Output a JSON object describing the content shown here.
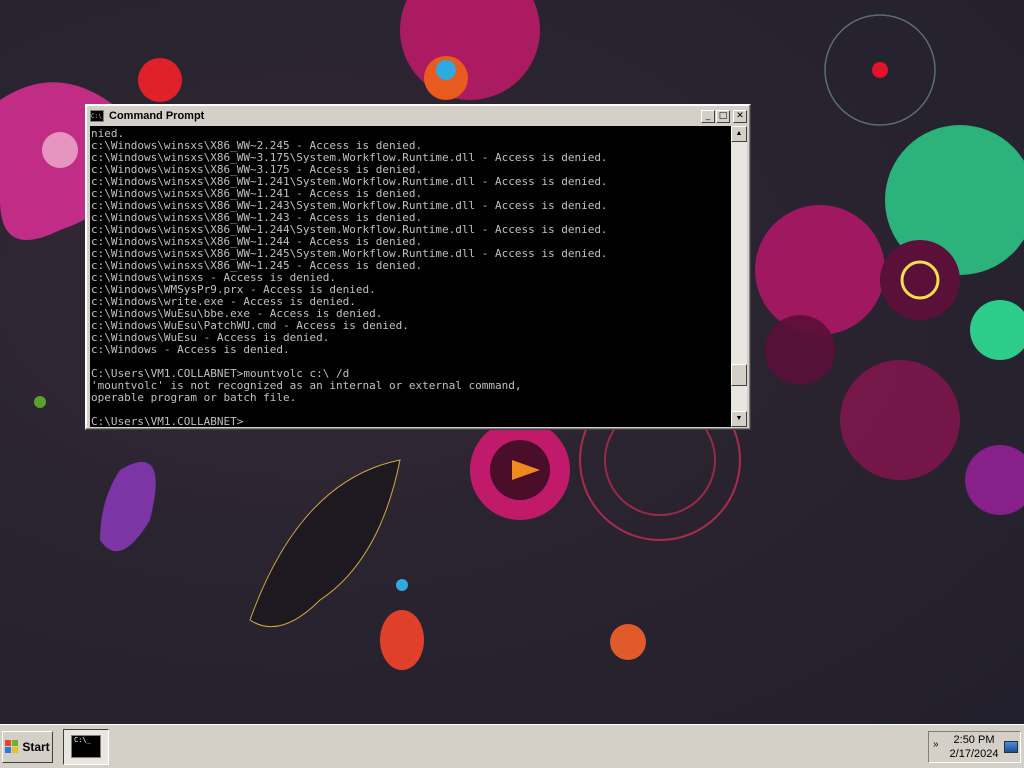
{
  "window": {
    "title": "Command Prompt",
    "buttons": {
      "minimize": "_",
      "maximize": "□",
      "close": "✕"
    },
    "console_lines": [
      "nied.",
      "c:\\Windows\\winsxs\\X86_WW~2.245 - Access is denied.",
      "c:\\Windows\\winsxs\\X86_WW~3.175\\System.Workflow.Runtime.dll - Access is denied.",
      "c:\\Windows\\winsxs\\X86_WW~3.175 - Access is denied.",
      "c:\\Windows\\winsxs\\X86_WW~1.241\\System.Workflow.Runtime.dll - Access is denied.",
      "c:\\Windows\\winsxs\\X86_WW~1.241 - Access is denied.",
      "c:\\Windows\\winsxs\\X86_WW~1.243\\System.Workflow.Runtime.dll - Access is denied.",
      "c:\\Windows\\winsxs\\X86_WW~1.243 - Access is denied.",
      "c:\\Windows\\winsxs\\X86_WW~1.244\\System.Workflow.Runtime.dll - Access is denied.",
      "c:\\Windows\\winsxs\\X86_WW~1.244 - Access is denied.",
      "c:\\Windows\\winsxs\\X86_WW~1.245\\System.Workflow.Runtime.dll - Access is denied.",
      "c:\\Windows\\winsxs\\X86_WW~1.245 - Access is denied.",
      "c:\\Windows\\winsxs - Access is denied.",
      "c:\\Windows\\WMSysPr9.prx - Access is denied.",
      "c:\\Windows\\write.exe - Access is denied.",
      "c:\\Windows\\WuEsu\\bbe.exe - Access is denied.",
      "c:\\Windows\\WuEsu\\PatchWU.cmd - Access is denied.",
      "c:\\Windows\\WuEsu - Access is denied.",
      "c:\\Windows - Access is denied.",
      "",
      "C:\\Users\\VM1.COLLABNET>mountvolc c:\\ /d",
      "'mountvolc' is not recognized as an internal or external command,",
      "operable program or batch file.",
      "",
      "C:\\Users\\VM1.COLLABNET>_"
    ],
    "scroll_position": 0.9
  },
  "taskbar": {
    "start_label": "Start",
    "task_icon_text": "C:\\_",
    "clock_time": "2:50 PM",
    "clock_date": "2/17/2024",
    "tray_chevron": "»"
  },
  "icons": {
    "title": "console-icon",
    "start": "windows-logo-icon",
    "task": "console-icon",
    "tray": "network-icon"
  }
}
